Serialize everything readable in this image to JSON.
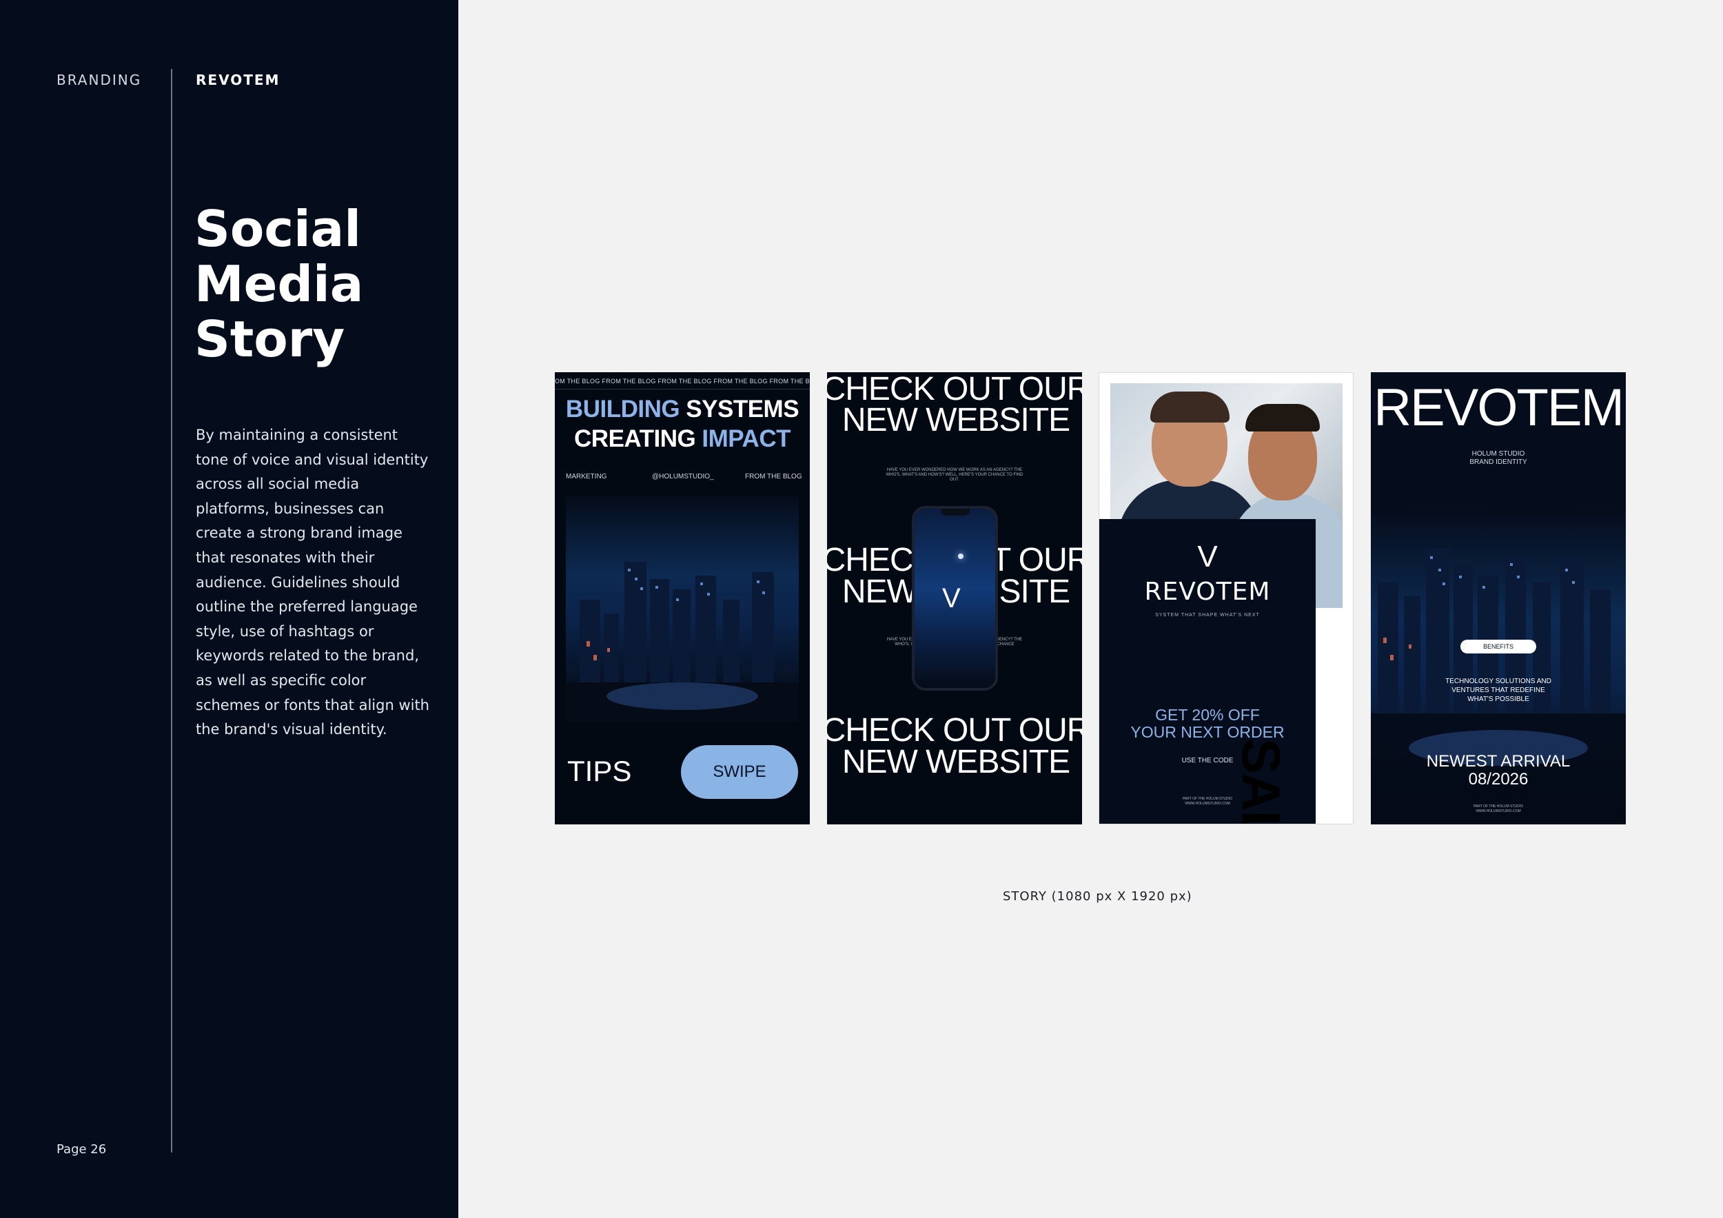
{
  "sidebar": {
    "section": "BRANDING",
    "brand": "REVOTEM",
    "title_lines": [
      "Social",
      "Media",
      "Story"
    ],
    "description": "By maintaining a consistent tone of voice and visual identity across all social media platforms, businesses can create a strong brand image that resonates with their audience. Guidelines should outline the preferred language style, use of hashtags or keywords related to the brand, as well as specific color schemes or fonts that align with the brand's visual identity.",
    "page": "Page 26"
  },
  "colors": {
    "navy": "#050d1d",
    "accent_blue": "#8eb3e8",
    "button_blue": "#8ab4e6",
    "page_bg": "#f2f2f2"
  },
  "caption": "STORY (1080 px X 1920 px)",
  "card1": {
    "ticker": "OM THE BLOG   FROM THE BLOG   FROM THE BLOG   FROM THE BLOG   FROM THE BLOG   FROM THE BLO",
    "headline_a_hl": "BUILDING",
    "headline_a_wh": " SYSTEMS",
    "headline_b_wh": "CREATING ",
    "headline_b_hl": "IMPACT",
    "meta_left": "MARKETING",
    "meta_center": "@HOLUMSTUDIO_",
    "meta_right": "FROM THE BLOG",
    "tips": "TIPS",
    "swipe": "SWIPE"
  },
  "card2": {
    "line1": "CHECK OUT OUR",
    "line2": "NEW WEBSITE",
    "small_top": "HAVE YOU EVER WONDERED HOW WE WORK AS AN AGENCY? THE WHO'S, WHAT'S AND HOW'S? WELL, HERE'S YOUR CHANCE TO FIND OUT.",
    "mid_line1": "CHECK OUT OUR",
    "mid_line2": "NEW WEBSITE",
    "small_mid": "HAVE YOU EVER WONDERED HOW WE WORK AS AN AGENCY? THE WHO'S, WHAT'S AND HOW'S? WELL, HERE'S YOUR CHANCE",
    "bottom_line1": "CHECK OUT OUR",
    "bottom_line2": "NEW WEBSITE",
    "phone_logo": "V"
  },
  "card3": {
    "logo": "V",
    "name": "REVOTEM",
    "tagline": "SYSTEM THAT SHAPE WHAT'S NEXT",
    "offer_line1": "GET 20% OFF",
    "offer_line2": "YOUR NEXT ORDER",
    "code": "USE THE CODE",
    "foot_line1": "PART OF THE HOLUM STUDIO",
    "foot_line2": "WWW.HOLUMSTUDIO.COM",
    "sale": "SALE"
  },
  "card4": {
    "brand": "REVOTEM",
    "sub_line1": "HOLUM STUDIO",
    "sub_line2": "BRAND IDENTITY",
    "benefits": "BENEFITS",
    "tech_line1": "TECHNOLOGY SOLUTIONS AND",
    "tech_line2": "VENTURES THAT REDEFINE",
    "tech_line3": "WHAT'S POSSIBLE",
    "arrival_line1": "NEWEST ARRIVAL",
    "arrival_line2": "08/2026",
    "foot_line1": "PART OF THE HOLUM STUDIO",
    "foot_line2": "WWW.HOLUMSTUDIO.COM"
  }
}
